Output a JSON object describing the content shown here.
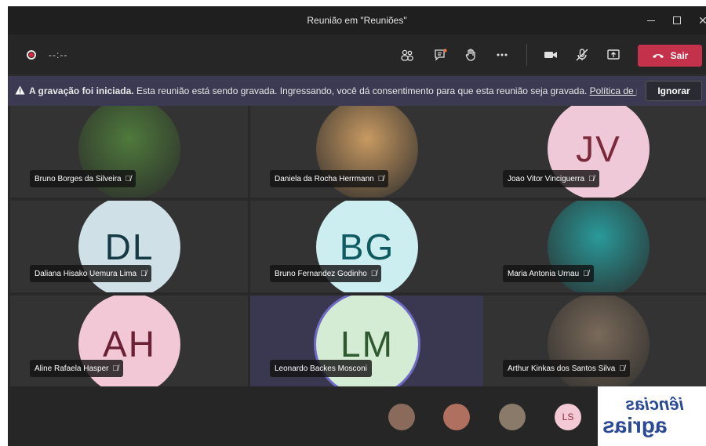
{
  "window": {
    "title": "Reunião em \"Reuniões\""
  },
  "toolbar": {
    "timer": "--:--",
    "leave_label": "Sair",
    "icons": [
      "participants-icon",
      "chat-icon",
      "raise-hand-icon",
      "more-icon",
      "camera-icon",
      "mic-off-icon",
      "share-icon",
      "phone-icon"
    ]
  },
  "notice": {
    "bold": "A gravação foi iniciada.",
    "text": " Esta reunião está sendo gravada. Ingressando, você dá consentimento para que esta reunião seja gravada. ",
    "link": "Política de pr...",
    "dismiss_label": "Ignorar"
  },
  "participants": [
    {
      "name": "Bruno Borges da Silveira",
      "initials": "",
      "photo": true,
      "bg": "#4f7a3c",
      "fg": "#ffffff"
    },
    {
      "name": "Daniela da Rocha Herrmann",
      "initials": "",
      "photo": true,
      "bg": "#c89a62",
      "fg": "#ffffff"
    },
    {
      "name": "Joao Vitor Vinciguerra",
      "initials": "JV",
      "photo": false,
      "bg": "#f0c9d8",
      "fg": "#7a2a3a"
    },
    {
      "name": "Daliana Hisako Uemura Lima",
      "initials": "DL",
      "photo": false,
      "bg": "#cfe0e6",
      "fg": "#163a44"
    },
    {
      "name": "Bruno Fernandez Godinho",
      "initials": "BG",
      "photo": false,
      "bg": "#cdeef0",
      "fg": "#0e5a60"
    },
    {
      "name": "Maria Antonia Urnau",
      "initials": "",
      "photo": true,
      "bg": "#2a9a9a",
      "fg": "#ffffff"
    },
    {
      "name": "Aline Rafaela Hasper",
      "initials": "AH",
      "photo": false,
      "bg": "#f2c7d6",
      "fg": "#6a2035"
    },
    {
      "name": "Leonardo Backes Mosconi",
      "initials": "LM",
      "photo": false,
      "bg": "#d4ecd4",
      "fg": "#2f5a2f",
      "speaking": true
    },
    {
      "name": "Arthur Kinkas dos Santos Silva",
      "initials": "",
      "photo": true,
      "bg": "#7a6a5a",
      "fg": "#ffffff"
    }
  ],
  "roster": [
    {
      "initials": "",
      "bg": "#8a6a5a"
    },
    {
      "initials": "",
      "bg": "#b07060"
    },
    {
      "initials": "",
      "bg": "#8a7a6a"
    },
    {
      "initials": "LS",
      "bg": "#f3c9d5",
      "fg": "#8a2a3a"
    }
  ],
  "selfview": {
    "line1": "iências",
    "line2": "agrias"
  },
  "colors": {
    "accent": "#6264a7",
    "leave": "#c4314b",
    "notice": "#3b3a52"
  }
}
